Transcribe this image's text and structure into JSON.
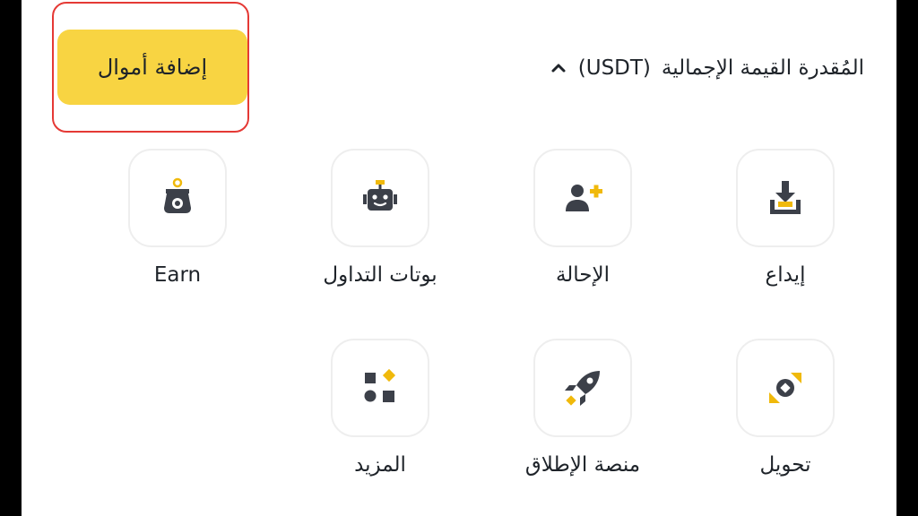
{
  "header": {
    "add_funds_label": "إضافة أموال",
    "balance_label": "المُقدرة القيمة الإجمالية",
    "currency": "(USDT)"
  },
  "actions": {
    "deposit": "إيداع",
    "referral": "الإحالة",
    "trading_bots": "بوتات التداول",
    "earn": "Earn",
    "convert": "تحويل",
    "launchpad": "منصة الإطلاق",
    "more": "المزيد"
  },
  "icons": {
    "deposit": "download-tray-icon",
    "referral": "add-user-icon",
    "trading_bots": "robot-icon",
    "earn": "coin-pot-icon",
    "convert": "coin-swap-icon",
    "launchpad": "rocket-icon",
    "more": "shapes-grid-icon",
    "balance_toggle": "chevron-up-icon"
  },
  "colors": {
    "accent": "#f8d442",
    "icon_yellow": "#f0b90b",
    "icon_dark": "#3c4049",
    "text": "#1e2329",
    "highlight": "#e53935"
  }
}
